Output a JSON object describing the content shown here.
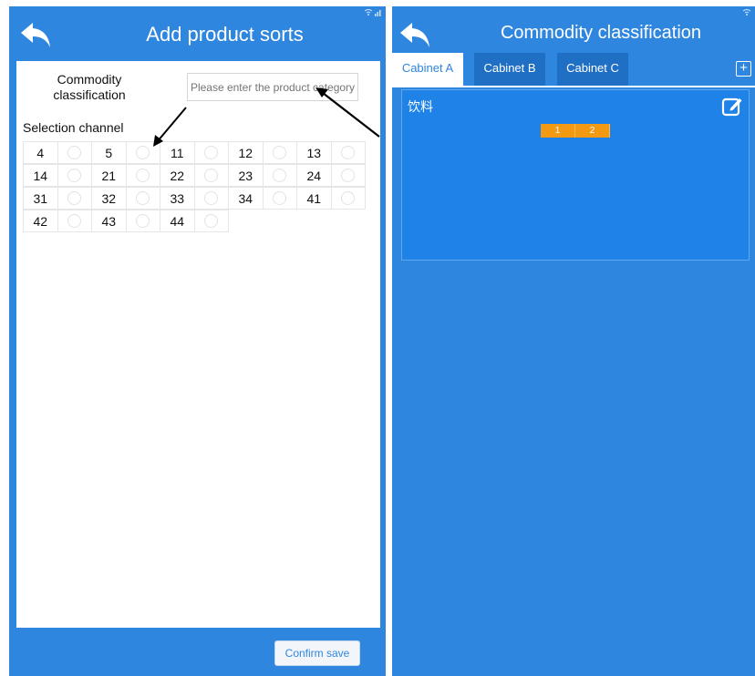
{
  "left_panel": {
    "title": "Add product sorts",
    "category_label": "Commodity classification",
    "category_input_placeholder": "Please enter the product category",
    "selection_label": "Selection channel",
    "channels": [
      [
        "4",
        "5",
        "11",
        "12",
        "13"
      ],
      [
        "14",
        "21",
        "22",
        "23",
        "24"
      ],
      [
        "31",
        "32",
        "33",
        "34",
        "41"
      ],
      [
        "42",
        "43",
        "44"
      ]
    ],
    "confirm_label": "Confirm save"
  },
  "right_panel": {
    "title": "Commodity classification",
    "tabs": [
      {
        "label": "Cabinet A",
        "active": true
      },
      {
        "label": "Cabinet B",
        "active": false
      },
      {
        "label": "Cabinet C",
        "active": false
      }
    ],
    "add_icon": "plus-square-icon",
    "group": {
      "name": "饮料",
      "channels": [
        "1",
        "2"
      ],
      "edit_icon": "edit-icon"
    }
  },
  "colors": {
    "primary_blue": "#2f86df",
    "dark_blue_tab": "#1f6fc4",
    "card_blue": "#1f82e6",
    "chip_orange": "#f39a12"
  },
  "icons": {
    "back": "back-arrow-icon",
    "status": "wifi-signal-icon"
  }
}
